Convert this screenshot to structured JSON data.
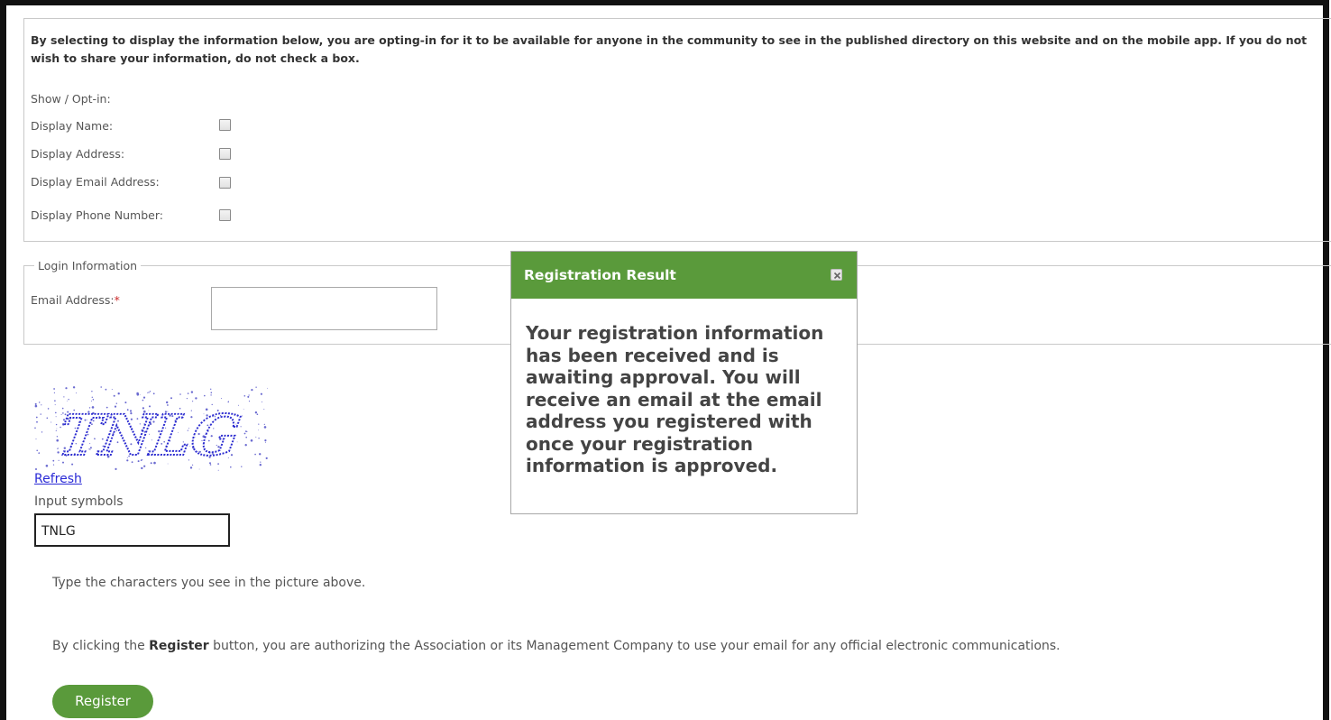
{
  "optin": {
    "disclaimer": "By selecting to display the information below, you are opting-in for it to be available for anyone in the community to see in the published directory on this website and on the mobile app. If you do not wish to share your information, do not check a box.",
    "show_label": "Show / Opt-in:",
    "fields": [
      {
        "label": "Display Name:",
        "checked": false
      },
      {
        "label": "Display Address:",
        "checked": false
      },
      {
        "label": "Display Email Address:",
        "checked": false
      },
      {
        "label": "Display Phone Number:",
        "checked": false
      }
    ]
  },
  "login": {
    "legend": "Login Information",
    "email_label": "Email Address:",
    "required_marker": "*",
    "email_value": ""
  },
  "captcha": {
    "image_text": "TNLG",
    "refresh_label": "Refresh",
    "input_label": "Input symbols",
    "input_value": "TNLG",
    "help_text": "Type the characters you see in the picture above."
  },
  "authorize": {
    "prefix": "By clicking the ",
    "bold": "Register",
    "suffix": " button, you are authorizing the Association or its Management Company to use your email for any official electronic communications."
  },
  "register_label": "Register",
  "modal": {
    "title": "Registration Result",
    "message": "Your registration information has been received and is awaiting approval. You will receive an email at the email address you registered with once your registration information is approved."
  },
  "colors": {
    "accent": "#5a9a3b",
    "link": "#2a2ad6",
    "required": "#cc2b2b"
  }
}
